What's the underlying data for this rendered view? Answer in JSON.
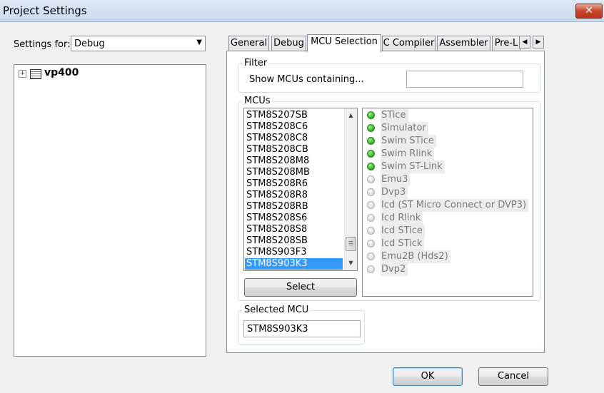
{
  "window": {
    "title": "Project Settings",
    "close_label": "✕"
  },
  "settings_for": {
    "label": "Settings for:",
    "value": "Debug"
  },
  "tree": {
    "expander": "+",
    "project": "vp400"
  },
  "tabs": [
    "General",
    "Debug",
    "MCU Selection",
    "C Compiler",
    "Assembler",
    "Pre-L"
  ],
  "active_tab": "MCU Selection",
  "tab_scroll": {
    "left": "◀",
    "right": "▶"
  },
  "filter": {
    "group_title": "Filter",
    "label": "Show MCUs containing...",
    "value": ""
  },
  "mcus": {
    "group_title": "MCUs",
    "items": [
      "STM8S207SB",
      "STM8S208C6",
      "STM8S208C8",
      "STM8S208CB",
      "STM8S208M8",
      "STM8S208MB",
      "STM8S208R6",
      "STM8S208R8",
      "STM8S208RB",
      "STM8S208S6",
      "STM8S208S8",
      "STM8S208SB",
      "STM8S903F3",
      "STM8S903K3"
    ],
    "selected": "STM8S903K3",
    "select_button": "Select"
  },
  "debuggers": [
    {
      "label": "STice",
      "supported": true
    },
    {
      "label": "Simulator",
      "supported": true
    },
    {
      "label": "Swim STice",
      "supported": true
    },
    {
      "label": "Swim Rlink",
      "supported": true
    },
    {
      "label": "Swim ST-Link",
      "supported": true
    },
    {
      "label": "Emu3",
      "supported": false
    },
    {
      "label": "Dvp3",
      "supported": false
    },
    {
      "label": "Icd (ST Micro Connect or DVP3)",
      "supported": false
    },
    {
      "label": "Icd Rlink",
      "supported": false
    },
    {
      "label": "Icd STice",
      "supported": false
    },
    {
      "label": "Icd STick",
      "supported": false
    },
    {
      "label": "Emu2B (Hds2)",
      "supported": false
    },
    {
      "label": "Dvp2",
      "supported": false
    }
  ],
  "selected_mcu": {
    "group_title": "Selected MCU",
    "value": "STM8S903K3"
  },
  "buttons": {
    "ok": "OK",
    "cancel": "Cancel"
  }
}
